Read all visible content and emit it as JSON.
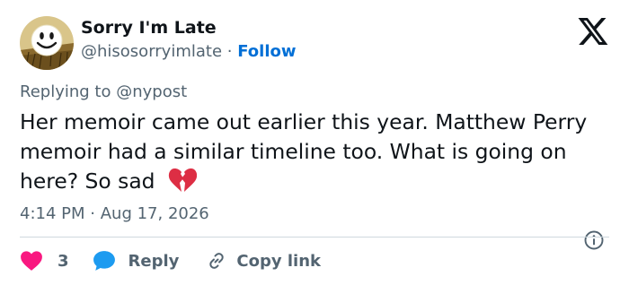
{
  "author": {
    "display_name": "Sorry I'm Late",
    "handle": "@hisosorryimlate",
    "separator": "·",
    "follow_label": "Follow"
  },
  "reply_context": {
    "prefix": "Replying to",
    "target": "@nypost"
  },
  "tweet": {
    "text": "Her memoir came out earlier this year. Matthew Perry memoir had a similar timeline too. What is going on here? So sad",
    "emoji_icon": "broken-heart-icon"
  },
  "meta": {
    "time": "4:14 PM",
    "separator": "·",
    "date": "Aug 17, 2026"
  },
  "actions": {
    "like_count": "3",
    "reply_label": "Reply",
    "copy_link_label": "Copy link"
  },
  "colors": {
    "text": "#0f1419",
    "secondary": "#536471",
    "link": "#006fd6",
    "like": "#f91880",
    "reply_bubble": "#1d9bf0",
    "divider": "#cfd9de"
  }
}
